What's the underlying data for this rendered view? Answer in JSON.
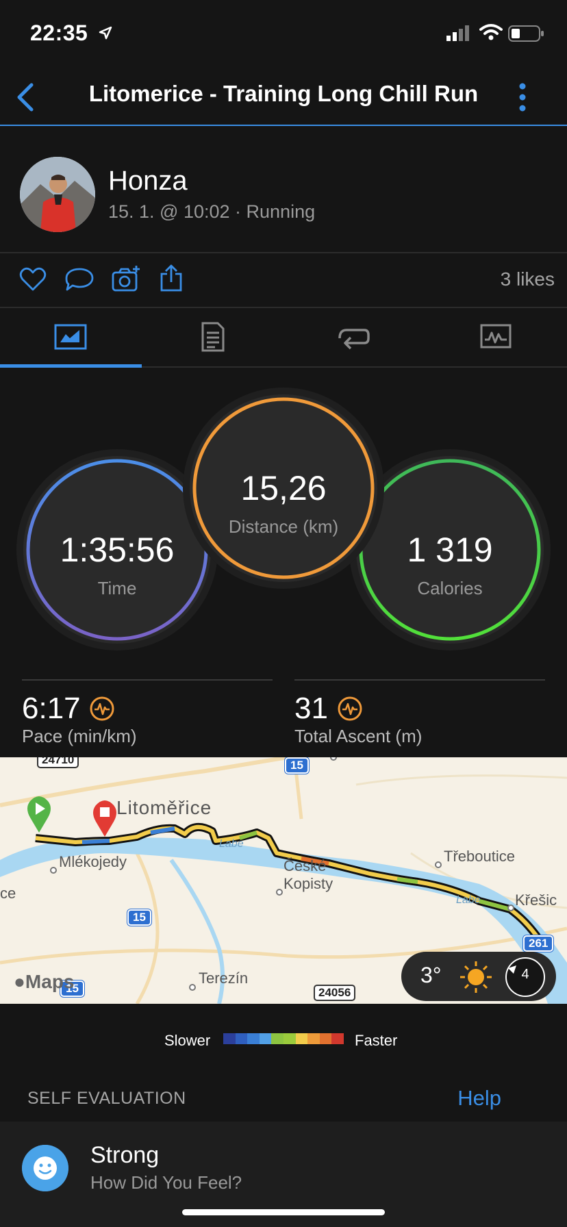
{
  "status_bar": {
    "time": "22:35"
  },
  "nav": {
    "title": "Litomerice - Training Long Chill Run"
  },
  "profile": {
    "name": "Honza",
    "subtitle": "15. 1. @ 10:02 · Running"
  },
  "social": {
    "likes": "3 likes"
  },
  "tabs": [
    {
      "name": "summary",
      "active": true
    },
    {
      "name": "details",
      "active": false
    },
    {
      "name": "laps",
      "active": false
    },
    {
      "name": "charts",
      "active": false
    }
  ],
  "stats": {
    "time": {
      "value": "1:35:56",
      "label": "Time"
    },
    "distance": {
      "value": "15,26",
      "label": "Distance (km)"
    },
    "calories": {
      "value": "1 319",
      "label": "Calories"
    }
  },
  "metrics": {
    "pace": {
      "value": "6:17",
      "label": "Pace (min/km)"
    },
    "ascent": {
      "value": "31",
      "label": "Total Ascent (m)"
    }
  },
  "map": {
    "places": {
      "litomerice": "Litoměřice",
      "mlekojedy": "Mlékojedy",
      "ceske": "České",
      "kopisty": "Kopisty",
      "treboutice": "Třeboutice",
      "kresice": "Křešic",
      "terezin": "Terezín",
      "labe1": "Labe",
      "labe2": "Labe",
      "ce": "ce",
      "top_badge": "24710"
    },
    "roads": {
      "r15a": "15",
      "r15b": "15",
      "r15c": "15",
      "r261": "261",
      "r24056": "24056"
    },
    "attribution": "Maps",
    "weather": {
      "temp": "3°",
      "wind": "4"
    }
  },
  "legend": {
    "slower": "Slower",
    "faster": "Faster",
    "colors": [
      "#2b3f9b",
      "#2f5fbf",
      "#3a7fd6",
      "#52a0e6",
      "#8dc441",
      "#9bcb3c",
      "#f2cc4b",
      "#ee9b3a",
      "#e2712f",
      "#d1382d"
    ]
  },
  "self_evaluation": {
    "heading": "SELF EVALUATION",
    "help": "Help",
    "feeling": "Strong",
    "question": "How Did You Feel?"
  },
  "colors": {
    "accent": "#3a8ee6",
    "time_ring": "#6a7bd6",
    "distance_ring": "#f09a3a",
    "calories_ring": "#49d43f"
  }
}
